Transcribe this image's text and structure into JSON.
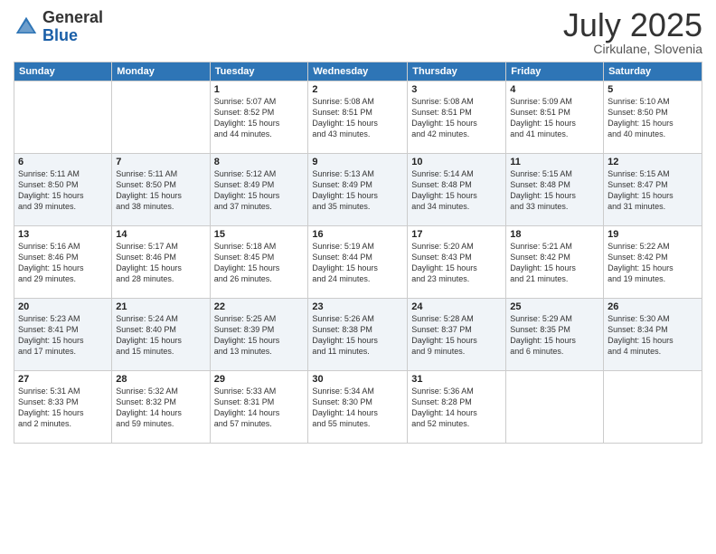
{
  "header": {
    "logo_general": "General",
    "logo_blue": "Blue",
    "month": "July 2025",
    "location": "Cirkulane, Slovenia"
  },
  "weekdays": [
    "Sunday",
    "Monday",
    "Tuesday",
    "Wednesday",
    "Thursday",
    "Friday",
    "Saturday"
  ],
  "rows": [
    [
      {
        "day": "",
        "info": ""
      },
      {
        "day": "",
        "info": ""
      },
      {
        "day": "1",
        "info": "Sunrise: 5:07 AM\nSunset: 8:52 PM\nDaylight: 15 hours\nand 44 minutes."
      },
      {
        "day": "2",
        "info": "Sunrise: 5:08 AM\nSunset: 8:51 PM\nDaylight: 15 hours\nand 43 minutes."
      },
      {
        "day": "3",
        "info": "Sunrise: 5:08 AM\nSunset: 8:51 PM\nDaylight: 15 hours\nand 42 minutes."
      },
      {
        "day": "4",
        "info": "Sunrise: 5:09 AM\nSunset: 8:51 PM\nDaylight: 15 hours\nand 41 minutes."
      },
      {
        "day": "5",
        "info": "Sunrise: 5:10 AM\nSunset: 8:50 PM\nDaylight: 15 hours\nand 40 minutes."
      }
    ],
    [
      {
        "day": "6",
        "info": "Sunrise: 5:11 AM\nSunset: 8:50 PM\nDaylight: 15 hours\nand 39 minutes."
      },
      {
        "day": "7",
        "info": "Sunrise: 5:11 AM\nSunset: 8:50 PM\nDaylight: 15 hours\nand 38 minutes."
      },
      {
        "day": "8",
        "info": "Sunrise: 5:12 AM\nSunset: 8:49 PM\nDaylight: 15 hours\nand 37 minutes."
      },
      {
        "day": "9",
        "info": "Sunrise: 5:13 AM\nSunset: 8:49 PM\nDaylight: 15 hours\nand 35 minutes."
      },
      {
        "day": "10",
        "info": "Sunrise: 5:14 AM\nSunset: 8:48 PM\nDaylight: 15 hours\nand 34 minutes."
      },
      {
        "day": "11",
        "info": "Sunrise: 5:15 AM\nSunset: 8:48 PM\nDaylight: 15 hours\nand 33 minutes."
      },
      {
        "day": "12",
        "info": "Sunrise: 5:15 AM\nSunset: 8:47 PM\nDaylight: 15 hours\nand 31 minutes."
      }
    ],
    [
      {
        "day": "13",
        "info": "Sunrise: 5:16 AM\nSunset: 8:46 PM\nDaylight: 15 hours\nand 29 minutes."
      },
      {
        "day": "14",
        "info": "Sunrise: 5:17 AM\nSunset: 8:46 PM\nDaylight: 15 hours\nand 28 minutes."
      },
      {
        "day": "15",
        "info": "Sunrise: 5:18 AM\nSunset: 8:45 PM\nDaylight: 15 hours\nand 26 minutes."
      },
      {
        "day": "16",
        "info": "Sunrise: 5:19 AM\nSunset: 8:44 PM\nDaylight: 15 hours\nand 24 minutes."
      },
      {
        "day": "17",
        "info": "Sunrise: 5:20 AM\nSunset: 8:43 PM\nDaylight: 15 hours\nand 23 minutes."
      },
      {
        "day": "18",
        "info": "Sunrise: 5:21 AM\nSunset: 8:42 PM\nDaylight: 15 hours\nand 21 minutes."
      },
      {
        "day": "19",
        "info": "Sunrise: 5:22 AM\nSunset: 8:42 PM\nDaylight: 15 hours\nand 19 minutes."
      }
    ],
    [
      {
        "day": "20",
        "info": "Sunrise: 5:23 AM\nSunset: 8:41 PM\nDaylight: 15 hours\nand 17 minutes."
      },
      {
        "day": "21",
        "info": "Sunrise: 5:24 AM\nSunset: 8:40 PM\nDaylight: 15 hours\nand 15 minutes."
      },
      {
        "day": "22",
        "info": "Sunrise: 5:25 AM\nSunset: 8:39 PM\nDaylight: 15 hours\nand 13 minutes."
      },
      {
        "day": "23",
        "info": "Sunrise: 5:26 AM\nSunset: 8:38 PM\nDaylight: 15 hours\nand 11 minutes."
      },
      {
        "day": "24",
        "info": "Sunrise: 5:28 AM\nSunset: 8:37 PM\nDaylight: 15 hours\nand 9 minutes."
      },
      {
        "day": "25",
        "info": "Sunrise: 5:29 AM\nSunset: 8:35 PM\nDaylight: 15 hours\nand 6 minutes."
      },
      {
        "day": "26",
        "info": "Sunrise: 5:30 AM\nSunset: 8:34 PM\nDaylight: 15 hours\nand 4 minutes."
      }
    ],
    [
      {
        "day": "27",
        "info": "Sunrise: 5:31 AM\nSunset: 8:33 PM\nDaylight: 15 hours\nand 2 minutes."
      },
      {
        "day": "28",
        "info": "Sunrise: 5:32 AM\nSunset: 8:32 PM\nDaylight: 14 hours\nand 59 minutes."
      },
      {
        "day": "29",
        "info": "Sunrise: 5:33 AM\nSunset: 8:31 PM\nDaylight: 14 hours\nand 57 minutes."
      },
      {
        "day": "30",
        "info": "Sunrise: 5:34 AM\nSunset: 8:30 PM\nDaylight: 14 hours\nand 55 minutes."
      },
      {
        "day": "31",
        "info": "Sunrise: 5:36 AM\nSunset: 8:28 PM\nDaylight: 14 hours\nand 52 minutes."
      },
      {
        "day": "",
        "info": ""
      },
      {
        "day": "",
        "info": ""
      }
    ]
  ]
}
